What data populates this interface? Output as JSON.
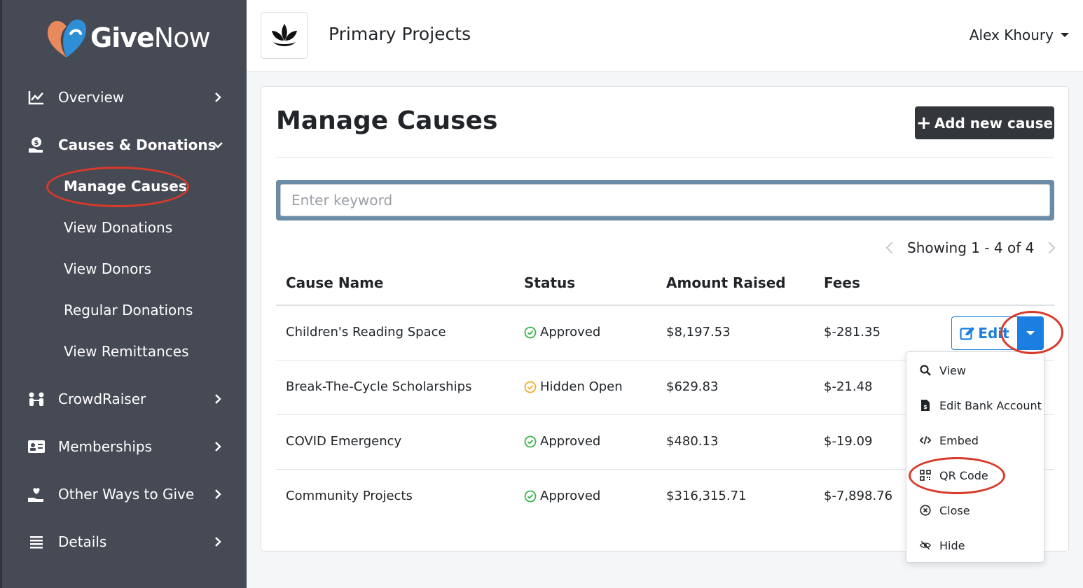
{
  "brand": {
    "name_bold": "Give",
    "name_light": "Now",
    "accent_blue": "#2e8fd6",
    "accent_orange": "#e98a5c"
  },
  "sidebar": {
    "items": [
      {
        "label": "Overview",
        "icon": "chart-line-icon"
      },
      {
        "label": "Causes & Donations",
        "icon": "hand-coin-icon",
        "expanded": true
      },
      {
        "label": "CrowdRaiser",
        "icon": "people-icon"
      },
      {
        "label": "Memberships",
        "icon": "id-card-icon"
      },
      {
        "label": "Other Ways to Give",
        "icon": "hand-heart-icon"
      },
      {
        "label": "Details",
        "icon": "list-icon"
      }
    ],
    "sub_items": [
      {
        "label": "Manage Causes",
        "active": true
      },
      {
        "label": "View Donations"
      },
      {
        "label": "View Donors"
      },
      {
        "label": "Regular Donations"
      },
      {
        "label": "View Remittances"
      }
    ]
  },
  "header": {
    "org_name": "Primary Projects",
    "user_name": "Alex Khoury"
  },
  "main": {
    "title": "Manage Causes",
    "add_button": "Add new cause",
    "search": {
      "placeholder": "Enter keyword",
      "value": ""
    },
    "pager": {
      "text": "Showing 1 - 4 of 4"
    },
    "columns": [
      "Cause Name",
      "Status",
      "Amount Raised",
      "Fees"
    ],
    "rows": [
      {
        "name": "Children's Reading Space",
        "status": "Approved",
        "status_color": "#3bb54a",
        "amount": "$8,197.53",
        "fees": "$-281.35"
      },
      {
        "name": "Break-The-Cycle Scholarships",
        "status": "Hidden Open",
        "status_color": "#f0ad30",
        "amount": "$629.83",
        "fees": "$-21.48"
      },
      {
        "name": "COVID Emergency",
        "status": "Approved",
        "status_color": "#3bb54a",
        "amount": "$480.13",
        "fees": "$-19.09"
      },
      {
        "name": "Community Projects",
        "status": "Approved",
        "status_color": "#3bb54a",
        "amount": "$316,315.71",
        "fees": "$-7,898.76"
      }
    ],
    "edit_button": "Edit",
    "dropdown": [
      {
        "label": "View",
        "icon": "search-icon"
      },
      {
        "label": "Edit Bank Account",
        "icon": "file-dollar-icon"
      },
      {
        "label": "Embed",
        "icon": "code-icon"
      },
      {
        "label": "QR Code",
        "icon": "qrcode-icon"
      },
      {
        "label": "Close",
        "icon": "circle-x-icon"
      },
      {
        "label": "Hide",
        "icon": "eye-slash-icon"
      }
    ]
  }
}
